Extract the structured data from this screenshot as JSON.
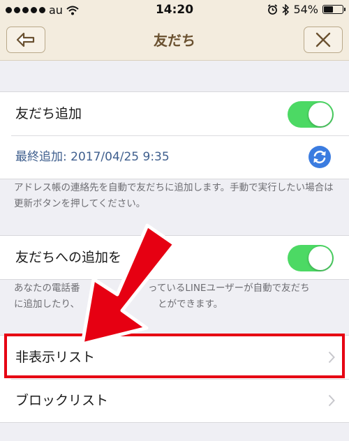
{
  "status_bar": {
    "carrier": "au",
    "time": "14:20",
    "battery": "54%",
    "battery_level": 0.54
  },
  "nav": {
    "title": "友だち",
    "back_icon": "back-arrow-icon",
    "close_icon": "close-icon"
  },
  "auto_add": {
    "label": "友だち追加",
    "enabled": true,
    "last_added": "最終追加: 2017/04/25 9:35",
    "description": "アドレス帳の連絡先を自動で友だちに追加します。手動で実行したい場合は更新ボタンを押してください。"
  },
  "allow_add": {
    "label": "友だちへの追加を",
    "enabled": true,
    "description_start": "あなたの電話番",
    "description_mid": "っているLINEユーザーが自動で友だち",
    "description_line2_start": "に追加したり、",
    "description_line2_end": "とができます。"
  },
  "lists": {
    "hidden": "非表示リスト",
    "blocked": "ブロックリスト"
  },
  "colors": {
    "nav_bg": "#f3ecde",
    "toggle_on": "#4cd964",
    "link_blue": "#3f5f8e",
    "highlight_red": "#e60012"
  }
}
